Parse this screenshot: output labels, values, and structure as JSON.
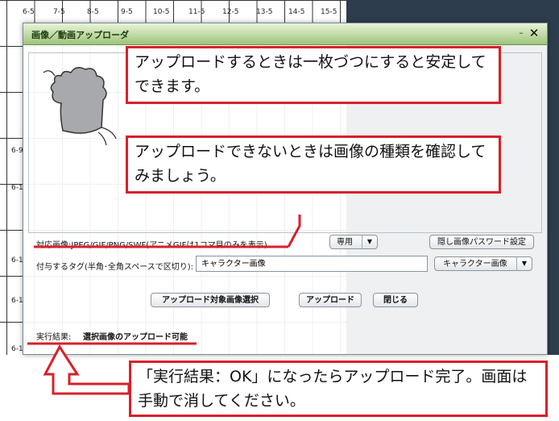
{
  "background_grid": {
    "labels_row1": [
      "6-5",
      "7-5",
      "8-5",
      "9-5",
      "10-5",
      "11-5",
      "12-5",
      "13-5",
      "14-5",
      "15-5"
    ],
    "side_labels": [
      "6-9",
      "6-1",
      "6-1",
      "6-1",
      "6-1"
    ]
  },
  "dialog": {
    "title": "画像／動画アップローダ",
    "minimize_icon": "–",
    "close_icon": "✕"
  },
  "callouts": {
    "upload_tip": "アップロードするときは一枚づつにすると安定してできます。",
    "cannot_upload_tip": "アップロードできないときは画像の種類を確認してみましょう。",
    "result_tip": "「実行結果：OK」になったらアップロード完了。画面は手動で消してください。"
  },
  "form": {
    "supported_label": "対応画像:JPEG/GIF/PNG/SWF(アニメGIFは1コマ目のみを表示)",
    "exclusive_select": "専用",
    "hidden_password_button": "隠し画像パスワード設定",
    "tag_label": "付与するタグ(半角･全角スペースで区切り):",
    "tag_value": "キャラクター画像",
    "category_select": "キャラクター画像",
    "select_file_button": "アップロード対象画像選択",
    "upload_button": "アップロード",
    "close_button": "閉じる",
    "result_label": "実行結果:",
    "result_value": "選択画像のアップロード可能"
  },
  "colors": {
    "callout_border": "#d8202a",
    "titlebar": "#9ec47a"
  }
}
